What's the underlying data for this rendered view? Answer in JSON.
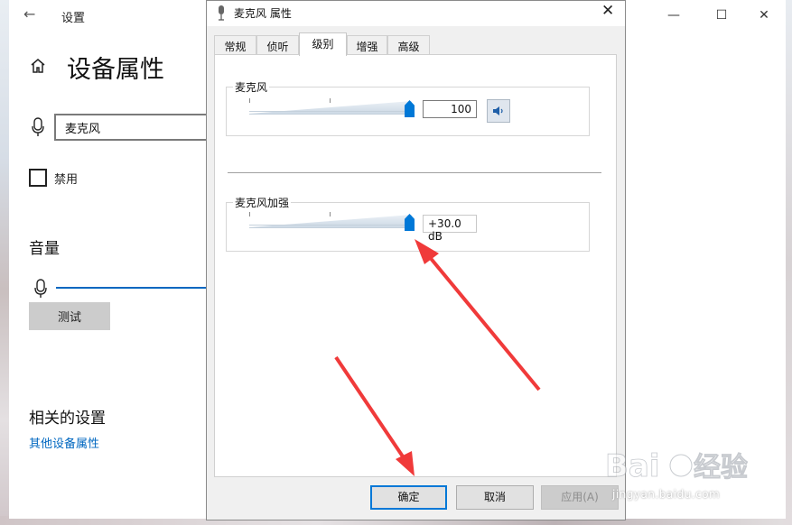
{
  "settings_window": {
    "title": "设置",
    "back_icon": "back-arrow-icon",
    "page_title": "设备属性",
    "device_name_value": "麦克风",
    "disable_label": "禁用",
    "volume_title": "音量",
    "test_button": "测试",
    "related_title": "相关的设置",
    "other_properties_link": "其他设备属性",
    "accent": "#0067c0"
  },
  "dialog": {
    "title": "麦克风 属性",
    "tabs": [
      {
        "label": "常规"
      },
      {
        "label": "侦听"
      },
      {
        "label": "级别",
        "active": true
      },
      {
        "label": "增强"
      },
      {
        "label": "高级"
      }
    ],
    "microphone_group": {
      "label": "麦克风",
      "level_value": "100",
      "level_fraction": 1.0,
      "speaker_icon": "speaker-icon"
    },
    "boost_group": {
      "label": "麦克风加强",
      "boost_value": "+30.0 dB",
      "boost_fraction": 1.0
    },
    "buttons": {
      "ok": "确定",
      "cancel": "取消",
      "apply": "应用(A)"
    },
    "accent": "#0078d7"
  },
  "window_controls": {
    "minimize": "—",
    "maximize": "☐",
    "close": "✕"
  },
  "annotation_color": "#f03a3a",
  "watermark_text": "jingyan.baidu.com"
}
